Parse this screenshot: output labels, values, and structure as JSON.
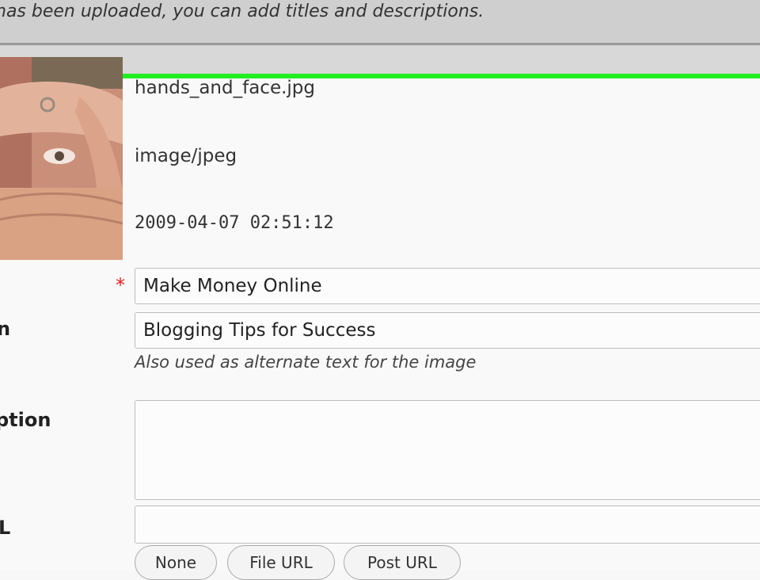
{
  "banner": {
    "message": "has been uploaded, you can add titles and descriptions."
  },
  "attachment": {
    "thumbnail_icon": "photo-thumbnail",
    "filename": "hands_and_face.jpg",
    "mime_type": "image/jpeg",
    "upload_date": "2009-04-07 02:51:12"
  },
  "form": {
    "title_label": "",
    "title_value": "Make Money Online",
    "required_marker": "*",
    "alt_label": "n",
    "alt_value": "Blogging Tips for Success",
    "alt_hint": "Also used as alternate text for the image",
    "caption_label": "ption",
    "caption_value": "",
    "link_url_label": "L",
    "link_url_value": "",
    "url_buttons": {
      "none": "None",
      "file_url": "File URL",
      "post_url": "Post URL"
    }
  },
  "colors": {
    "progress": "#22ee22",
    "required": "#dd2222"
  }
}
